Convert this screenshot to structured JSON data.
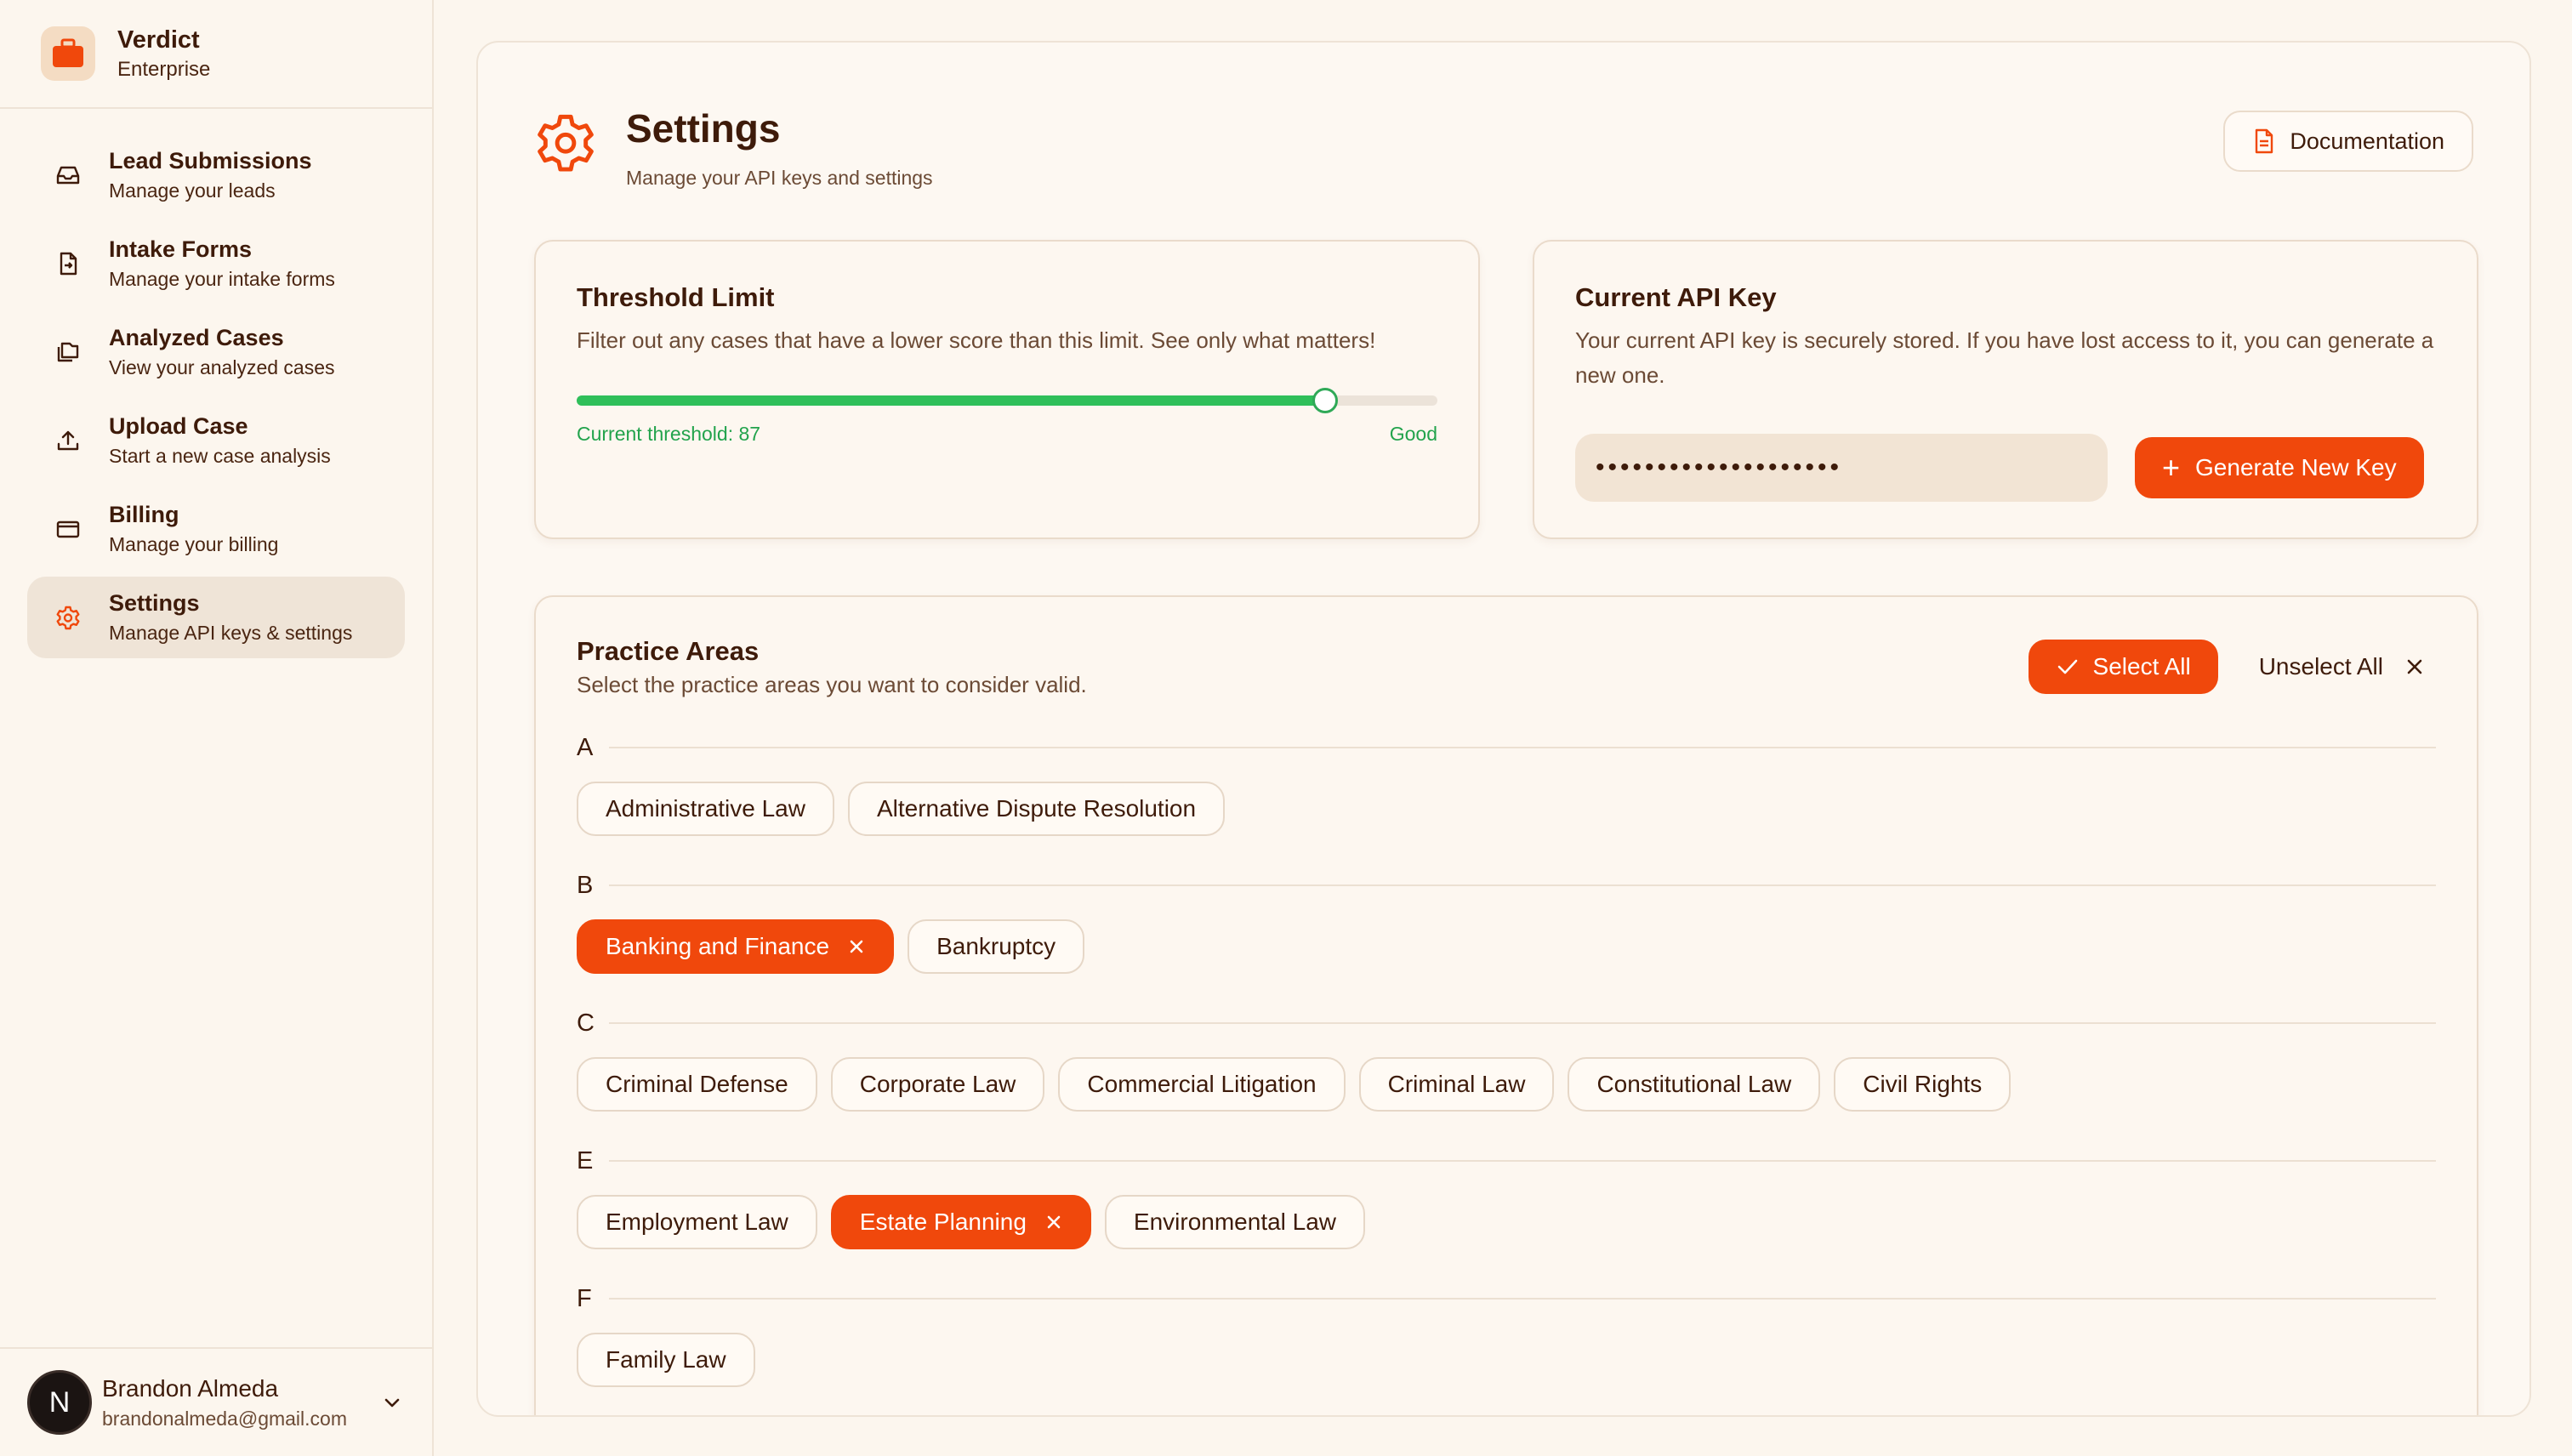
{
  "brand": {
    "name": "Verdict",
    "plan": "Enterprise"
  },
  "nav": [
    {
      "title": "Lead Submissions",
      "sub": "Manage your leads",
      "icon": "inbox-icon"
    },
    {
      "title": "Intake Forms",
      "sub": "Manage your intake forms",
      "icon": "file-import-icon"
    },
    {
      "title": "Analyzed Cases",
      "sub": "View your analyzed cases",
      "icon": "files-icon"
    },
    {
      "title": "Upload Case",
      "sub": "Start a new case analysis",
      "icon": "upload-icon"
    },
    {
      "title": "Billing",
      "sub": "Manage your billing",
      "icon": "credit-card-icon"
    },
    {
      "title": "Settings",
      "sub": "Manage API keys & settings",
      "icon": "gear-icon",
      "active": true
    }
  ],
  "user": {
    "initial": "N",
    "name": "Brandon Almeda",
    "email": "brandonalmeda@gmail.com"
  },
  "header": {
    "title": "Settings",
    "subtitle": "Manage your API keys and settings",
    "doc_label": "Documentation"
  },
  "threshold": {
    "title": "Threshold Limit",
    "desc": "Filter out any cases that have a lower score than this limit. See only what matters!",
    "value": 87,
    "max": 100,
    "current_label": "Current threshold: 87",
    "rating": "Good"
  },
  "apikey": {
    "title": "Current API Key",
    "desc": "Your current API key is securely stored. If you have lost access to it, you can generate a new one.",
    "masked": "••••••••••••••••••••",
    "generate_label": "Generate New Key"
  },
  "practice": {
    "title": "Practice Areas",
    "subtitle": "Select the practice areas you want to consider valid.",
    "select_all": "Select All",
    "unselect_all": "Unselect All",
    "groups": [
      {
        "letter": "A",
        "areas": [
          {
            "name": "Administrative Law",
            "selected": false
          },
          {
            "name": "Alternative Dispute Resolution",
            "selected": false
          }
        ]
      },
      {
        "letter": "B",
        "areas": [
          {
            "name": "Banking and Finance",
            "selected": true
          },
          {
            "name": "Bankruptcy",
            "selected": false
          }
        ]
      },
      {
        "letter": "C",
        "areas": [
          {
            "name": "Criminal Defense",
            "selected": false
          },
          {
            "name": "Corporate Law",
            "selected": false
          },
          {
            "name": "Commercial Litigation",
            "selected": false
          },
          {
            "name": "Criminal Law",
            "selected": false
          },
          {
            "name": "Constitutional Law",
            "selected": false
          },
          {
            "name": "Civil Rights",
            "selected": false
          }
        ]
      },
      {
        "letter": "E",
        "areas": [
          {
            "name": "Employment Law",
            "selected": false
          },
          {
            "name": "Estate Planning",
            "selected": true
          },
          {
            "name": "Environmental Law",
            "selected": false
          }
        ]
      },
      {
        "letter": "F",
        "areas": [
          {
            "name": "Family Law",
            "selected": false
          }
        ]
      }
    ]
  },
  "colors": {
    "accent": "#f0480c",
    "success": "#2fbf5a",
    "background": "#fcf6ee"
  }
}
